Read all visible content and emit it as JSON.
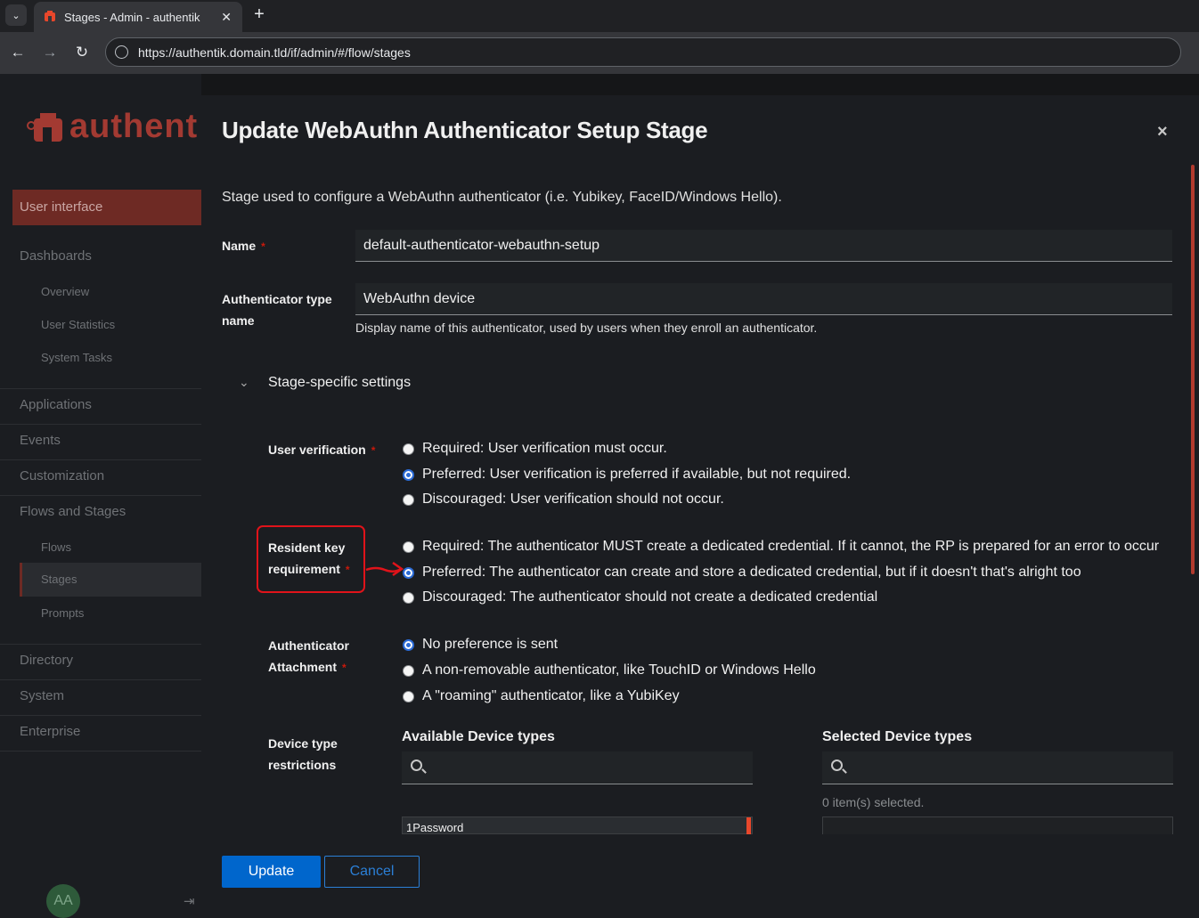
{
  "browser": {
    "tab_title": "Stages - Admin - authentik",
    "new_tab": "+",
    "close_tab": "✕",
    "url": "https://authentik.domain.tld/if/admin/#/flow/stages"
  },
  "sidebar": {
    "logo_text": "authent",
    "active_top": "User interface",
    "dashboards": "Dashboards",
    "overview": "Overview",
    "user_statistics": "User Statistics",
    "system_tasks": "System Tasks",
    "applications": "Applications",
    "events": "Events",
    "customization": "Customization",
    "flows_and_stages": "Flows and Stages",
    "flows": "Flows",
    "stages": "Stages",
    "prompts": "Prompts",
    "directory": "Directory",
    "system": "System",
    "enterprise": "Enterprise",
    "avatar": "AA"
  },
  "modal": {
    "title": "Update WebAuthn Authenticator Setup Stage",
    "close": "×",
    "description": "Stage used to configure a WebAuthn authenticator (i.e. Yubikey, FaceID/Windows Hello).",
    "name_label": "Name",
    "name_value": "default-authenticator-webauthn-setup",
    "authtype_label_1": "Authenticator type",
    "authtype_label_2": "name",
    "authtype_value": "WebAuthn device",
    "authtype_helper": "Display name of this authenticator, used by users when they enroll an authenticator.",
    "section_title": "Stage-specific settings",
    "required_mark": "*",
    "user_verification": {
      "label": "User verification",
      "options": [
        "Required: User verification must occur.",
        "Preferred: User verification is preferred if available, but not required.",
        "Discouraged: User verification should not occur."
      ],
      "selected": 1
    },
    "resident_key": {
      "label_1": "Resident key",
      "label_2": "requirement",
      "options": [
        "Required: The authenticator MUST create a dedicated credential. If it cannot, the RP is prepared for an error to occur",
        "Preferred: The authenticator can create and store a dedicated credential, but if it doesn't that's alright too",
        "Discouraged: The authenticator should not create a dedicated credential"
      ],
      "selected": 1
    },
    "attachment": {
      "label_1": "Authenticator",
      "label_2": "Attachment",
      "options": [
        "No preference is sent",
        "A non-removable authenticator, like TouchID or Windows Hello",
        "A \"roaming\" authenticator, like a YubiKey"
      ],
      "selected": 0
    },
    "device_types": {
      "label_1": "Device type",
      "label_2": "restrictions",
      "available_title": "Available Device types",
      "selected_title": "Selected Device types",
      "selected_count": "0 item(s) selected.",
      "available_items": [
        "1Password"
      ]
    },
    "update_button": "Update",
    "cancel_button": "Cancel"
  },
  "colors": {
    "accent_red": "#c9190b",
    "primary_blue": "#0066cc",
    "annotation_red": "#e0131a"
  }
}
